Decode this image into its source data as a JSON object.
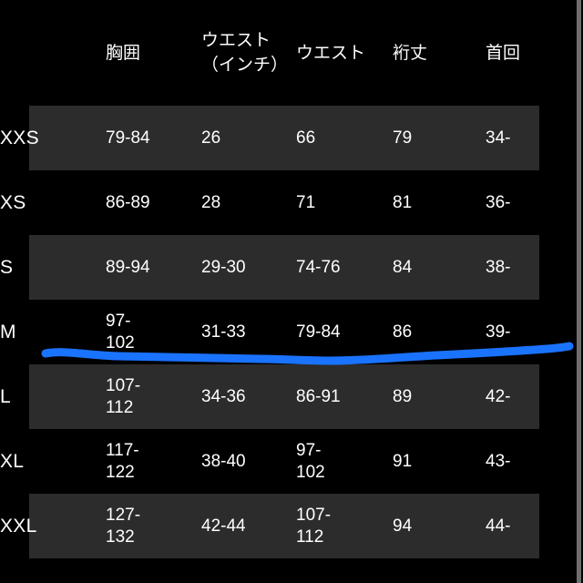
{
  "table": {
    "name": "size-chart",
    "columns": [
      {
        "key": "size",
        "label": ""
      },
      {
        "key": "chest",
        "label": "胸囲"
      },
      {
        "key": "waistin",
        "label": "ウエスト\n（インチ）"
      },
      {
        "key": "waist",
        "label": "ウエスト"
      },
      {
        "key": "sleeve",
        "label": "裄丈"
      },
      {
        "key": "neck",
        "label": "首回"
      }
    ],
    "rows": [
      {
        "size": "XXS",
        "chest": "79-84",
        "waistin": "26",
        "waist": "66",
        "sleeve": "79",
        "neck": "34-"
      },
      {
        "size": "XS",
        "chest": "86-89",
        "waistin": "28",
        "waist": "71",
        "sleeve": "81",
        "neck": "36-"
      },
      {
        "size": "S",
        "chest": "89-94",
        "waistin": "29-30",
        "waist": "74-76",
        "sleeve": "84",
        "neck": "38-"
      },
      {
        "size": "M",
        "chest": "97-102",
        "waistin": "31-33",
        "waist": "79-84",
        "sleeve": "86",
        "neck": "39-"
      },
      {
        "size": "L",
        "chest": "107-112",
        "waistin": "34-36",
        "waist": "86-91",
        "sleeve": "89",
        "neck": "42-"
      },
      {
        "size": "XL",
        "chest": "117-122",
        "waistin": "38-40",
        "waist": "97-102",
        "sleeve": "91",
        "neck": "43-"
      },
      {
        "size": "XXL",
        "chest": "127-132",
        "waistin": "42-44",
        "waist": "107-112",
        "sleeve": "94",
        "neck": "44-"
      }
    ]
  },
  "annotation": {
    "type": "freehand-underline",
    "color": "#1a73ff",
    "target_row": "M"
  },
  "colors": {
    "background": "#000000",
    "stripe": "#2c2c2c",
    "text": "#ffffff",
    "annotation": "#1a73ff",
    "page_edge": "#6e6e6e"
  }
}
